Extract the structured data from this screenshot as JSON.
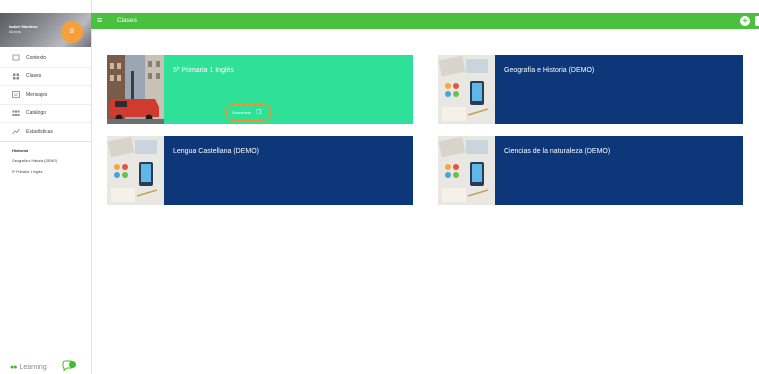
{
  "sidebar": {
    "profile": {
      "name": "Isabel Martínez",
      "role": "Alumna",
      "initial": "B"
    },
    "menu": [
      {
        "label": "Contexto",
        "icon": "page-icon"
      },
      {
        "label": "Clases",
        "icon": "grid-icon"
      },
      {
        "label": "Mensajes",
        "icon": "message-icon"
      },
      {
        "label": "Catálogo",
        "icon": "catalog-icon"
      },
      {
        "label": "Estadísticas",
        "icon": "stats-icon"
      }
    ],
    "recent_header": "Historial",
    "recent": [
      "Geografía e Historia (DEMO)",
      "5º Primaria 1 Inglés"
    ],
    "brand": "Learning"
  },
  "topbar": {
    "title": "Clases"
  },
  "cards": [
    {
      "title": "5º Primaria 1 Inglés",
      "subscribe_label": "Suscríbete"
    },
    {
      "title": "Geografía e Historia (DEMO)"
    },
    {
      "title": "Lengua Castellana (DEMO)"
    },
    {
      "title": "Ciencias de la naturaleza (DEMO)"
    }
  ],
  "colors": {
    "topbar": "#49c13f",
    "card_active": "#2ee098",
    "card_default": "#0e3779",
    "highlight": "#f0922e"
  }
}
